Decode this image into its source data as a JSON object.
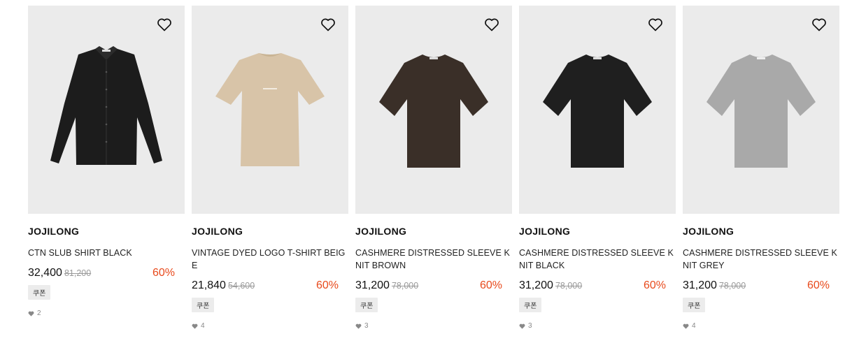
{
  "products": [
    {
      "brand": "JOJILONG",
      "name": "CTN SLUB SHIRT BLACK",
      "price": "32,400",
      "original_price": "81,200",
      "discount": "60%",
      "coupon": "쿠폰",
      "likes": "2",
      "color": "#1c1c1c"
    },
    {
      "brand": "JOJILONG",
      "name": "VINTAGE DYED LOGO T-SHIRT BEIGE",
      "price": "21,840",
      "original_price": "54,600",
      "discount": "60%",
      "coupon": "쿠폰",
      "likes": "4",
      "color": "#d8c4a8"
    },
    {
      "brand": "JOJILONG",
      "name": "CASHMERE DISTRESSED SLEEVE KNIT BROWN",
      "price": "31,200",
      "original_price": "78,000",
      "discount": "60%",
      "coupon": "쿠폰",
      "likes": "3",
      "color": "#3a2f28"
    },
    {
      "brand": "JOJILONG",
      "name": "CASHMERE DISTRESSED SLEEVE KNIT BLACK",
      "price": "31,200",
      "original_price": "78,000",
      "discount": "60%",
      "coupon": "쿠폰",
      "likes": "3",
      "color": "#1f1f1f"
    },
    {
      "brand": "JOJILONG",
      "name": "CASHMERE DISTRESSED SLEEVE KNIT GREY",
      "price": "31,200",
      "original_price": "78,000",
      "discount": "60%",
      "coupon": "쿠폰",
      "likes": "4",
      "color": "#a9a9a9"
    }
  ],
  "icons": {
    "wishlist": "heart-outline-icon",
    "likes": "heart-filled-icon"
  },
  "accent_color": "#e84a1c"
}
